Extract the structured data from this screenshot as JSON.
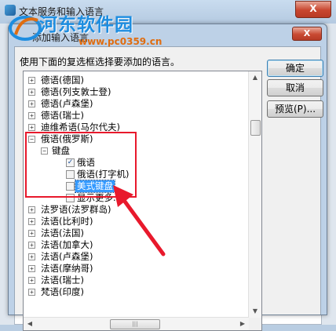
{
  "background_window": {
    "title": "文本服务和输入语言",
    "close_glyph": "X"
  },
  "dialog": {
    "title": "添加输入语言",
    "close_glyph": "X",
    "instruction": "使用下面的复选框选择要添加的语言。"
  },
  "watermark": {
    "text": "河东软件园",
    "url": "www.pc0359.cn"
  },
  "tree": {
    "rows_before": [
      "德语(德国)",
      "德语(列支敦士登)",
      "德语(卢森堡)",
      "德语(瑞士)",
      "迪维希语(马尔代夫)"
    ],
    "expanded_language": "俄语(俄罗斯)",
    "keyboard_node": "键盘",
    "keyboards": [
      {
        "label": "俄语",
        "checked": true,
        "selected": false
      },
      {
        "label": "俄语(打字机)",
        "checked": false,
        "selected": false
      },
      {
        "label": "美式键盘",
        "checked": false,
        "selected": true
      }
    ],
    "show_more": "显示更多...",
    "rows_after": [
      "法罗语(法罗群岛)",
      "法语(比利时)",
      "法语(法国)",
      "法语(加拿大)",
      "法语(卢森堡)",
      "法语(摩纳哥)",
      "法语(瑞士)",
      "梵语(印度)"
    ]
  },
  "buttons": {
    "ok": "确定",
    "cancel": "取消",
    "preview": "预览(P)..."
  },
  "glyphs": {
    "collapsed": "+",
    "expanded": "−",
    "check": "✓"
  },
  "annotation": {
    "color": "#e8192c"
  }
}
